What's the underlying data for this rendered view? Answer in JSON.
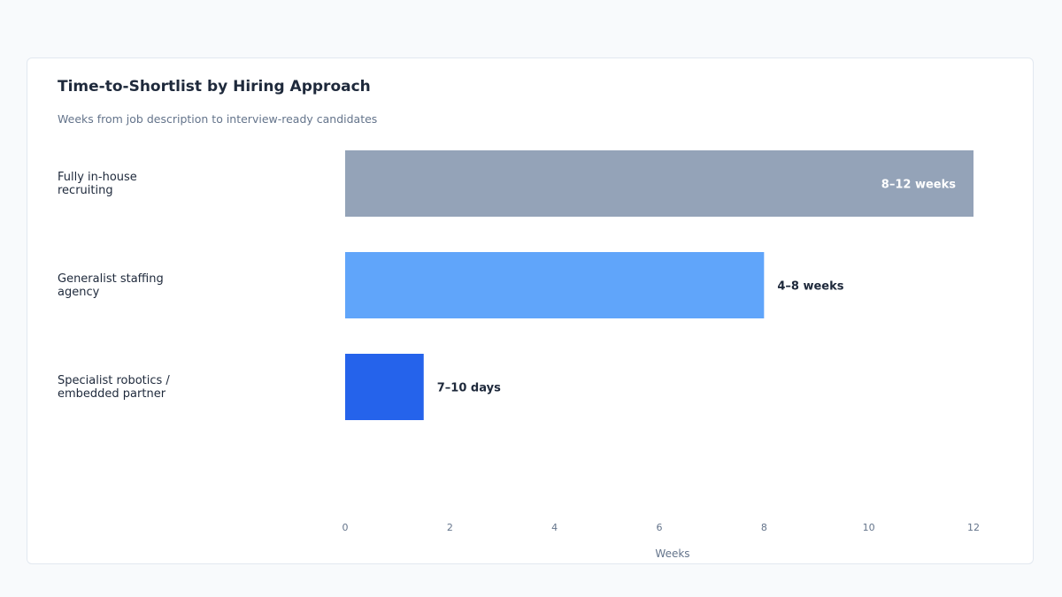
{
  "chart_data": {
    "type": "bar",
    "orientation": "horizontal",
    "title": "Time-to-Shortlist by Hiring Approach",
    "subtitle": "Weeks from job description to interview-ready candidates",
    "xlabel": "Weeks",
    "ylabel": "",
    "xlim": [
      0,
      12
    ],
    "xticks": [
      "0",
      "2",
      "4",
      "6",
      "8",
      "10",
      "12"
    ],
    "grid": false,
    "categories": [
      [
        "Fully in-house",
        "recruiting"
      ],
      [
        "Generalist staffing",
        "agency"
      ],
      [
        "Specialist robotics /",
        "embedded partner"
      ]
    ],
    "values": [
      12,
      8,
      1.5
    ],
    "data_labels": [
      "8–12 weeks",
      "4–8 weeks",
      "7–10 days"
    ],
    "label_inside": [
      true,
      false,
      false
    ],
    "colors": [
      "#94a3b8",
      "#60a5fa",
      "#2563eb"
    ]
  }
}
